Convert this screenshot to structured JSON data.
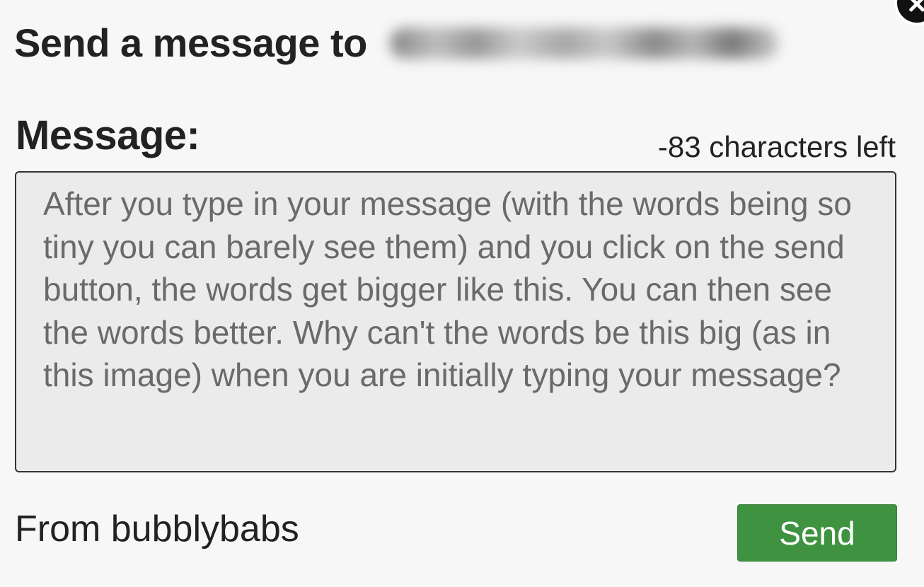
{
  "header": {
    "title": "Send a message to"
  },
  "icons": {
    "close": "close-icon"
  },
  "form": {
    "message_label": "Message:",
    "char_count": "-83 characters left",
    "message_text": "After you type in your message (with the words being so tiny you can barely see them) and you click on the send button, the words get bigger like this.  You can then see the words better.  Why can't the words be this big (as in this image) when you are initially typing your message?",
    "from_label": "From bubblybabs",
    "send_label": "Send"
  },
  "colors": {
    "send_button": "#3f9340",
    "background": "#f7f7f7",
    "textarea_bg": "#ebebeb"
  }
}
